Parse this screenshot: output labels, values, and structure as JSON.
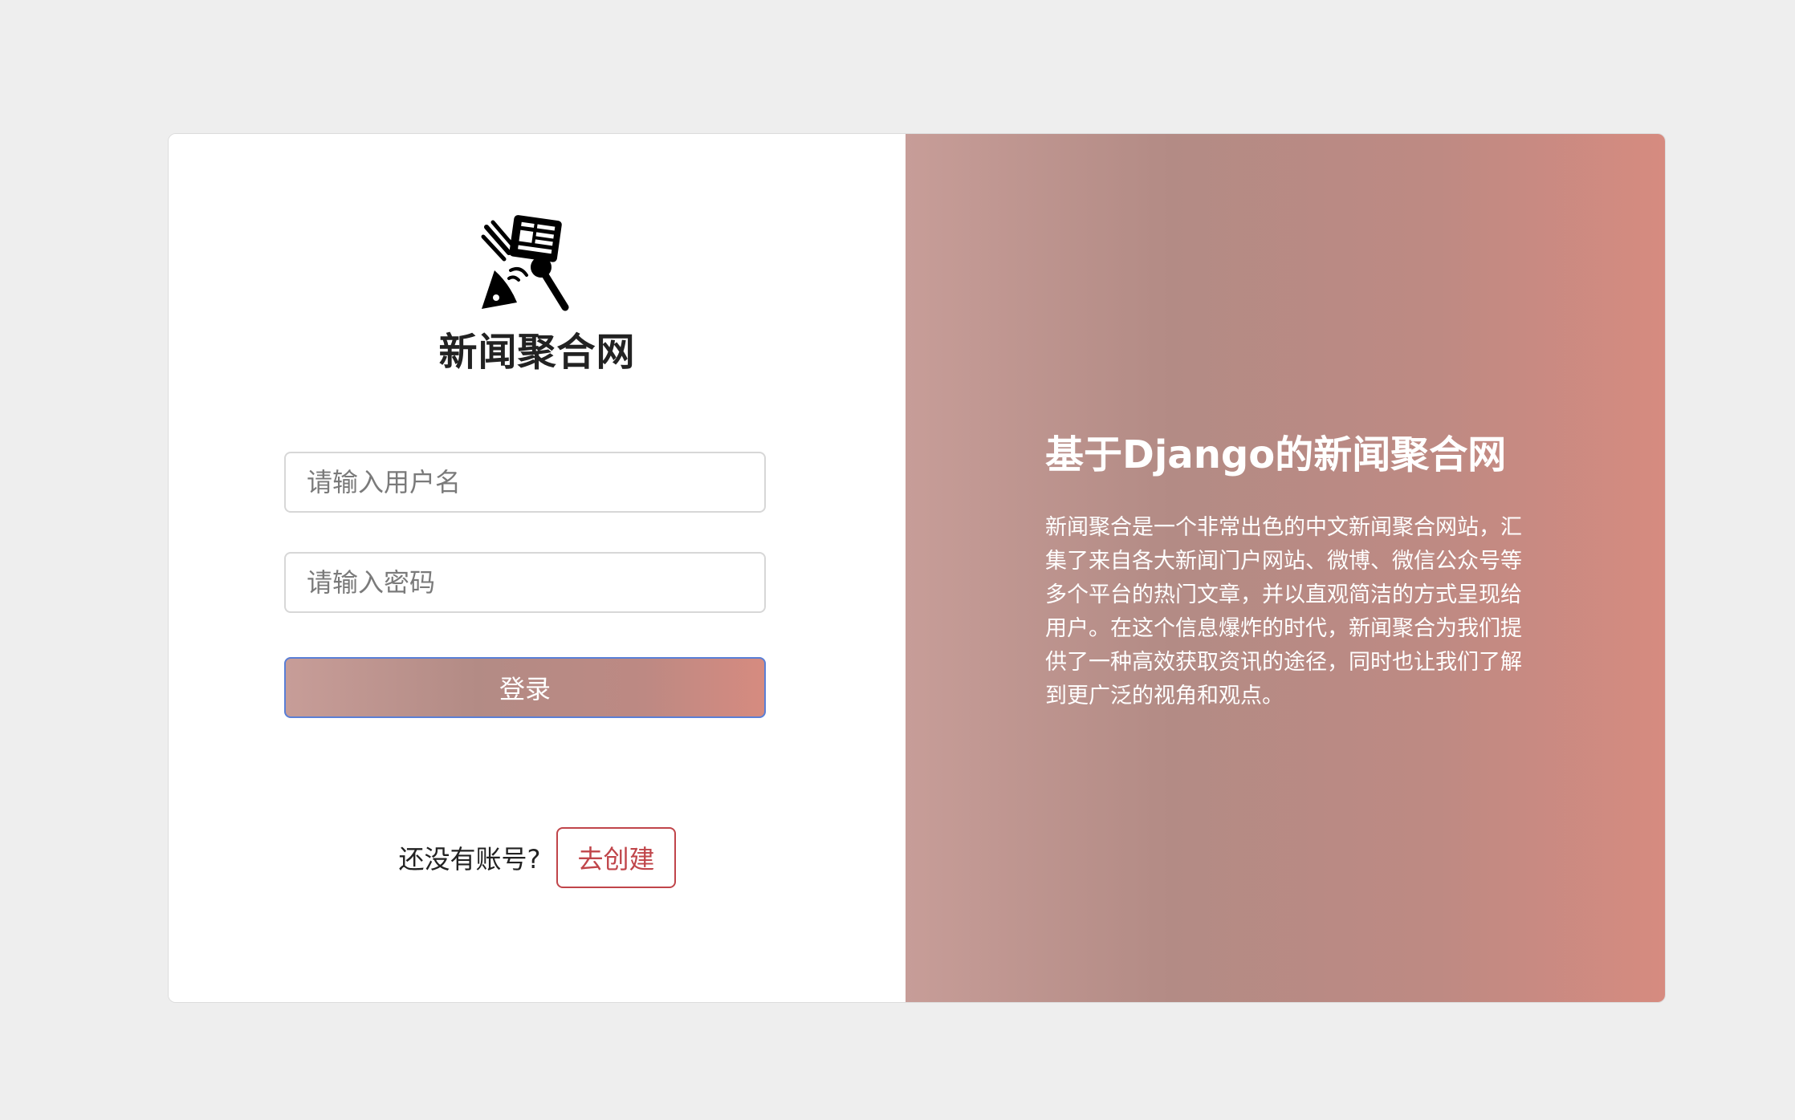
{
  "brand": {
    "title": "新闻聚合网",
    "logo_icon": "news-satellite-microphone-icon"
  },
  "login_form": {
    "username_placeholder": "请输入用户名",
    "password_placeholder": "请输入密码",
    "login_label": "登录"
  },
  "signup": {
    "prompt": "还没有账号?",
    "create_label": "去创建"
  },
  "info_panel": {
    "title": "基于Django的新闻聚合网",
    "description": "新闻聚合是一个非常出色的中文新闻聚合网站，汇集了来自各大新闻门户网站、微博、微信公众号等多个平台的热门文章，并以直观简洁的方式呈现给用户。在这个信息爆炸的时代，新闻聚合为我们提供了一种高效获取资讯的途径，同时也让我们了解到更广泛的视角和观点。"
  },
  "colors": {
    "page_background": "#eeeeee",
    "gradient_start": "#c79d98",
    "gradient_mid": "#b38b85",
    "gradient_end": "#d68b80",
    "create_button": "#c0454a",
    "login_border": "#5a7fd6"
  }
}
